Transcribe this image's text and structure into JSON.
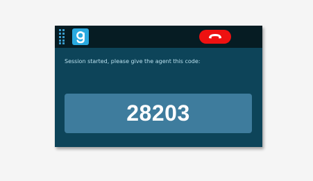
{
  "header": {
    "grip_icon": "drag-grip-icon",
    "logo_icon": "gotomeeting-g-logo-icon",
    "hangup_icon": "phone-hangup-icon",
    "hangup_color": "#ee1111"
  },
  "main": {
    "message": "Session started, please give the agent this code:",
    "code": "28203"
  },
  "colors": {
    "panel_bg": "#0d4459",
    "topbar_bg": "#061c23",
    "code_box_bg": "#3e7c9d",
    "message_text": "#b9e0ee",
    "logo_bg": "#29a9df"
  }
}
